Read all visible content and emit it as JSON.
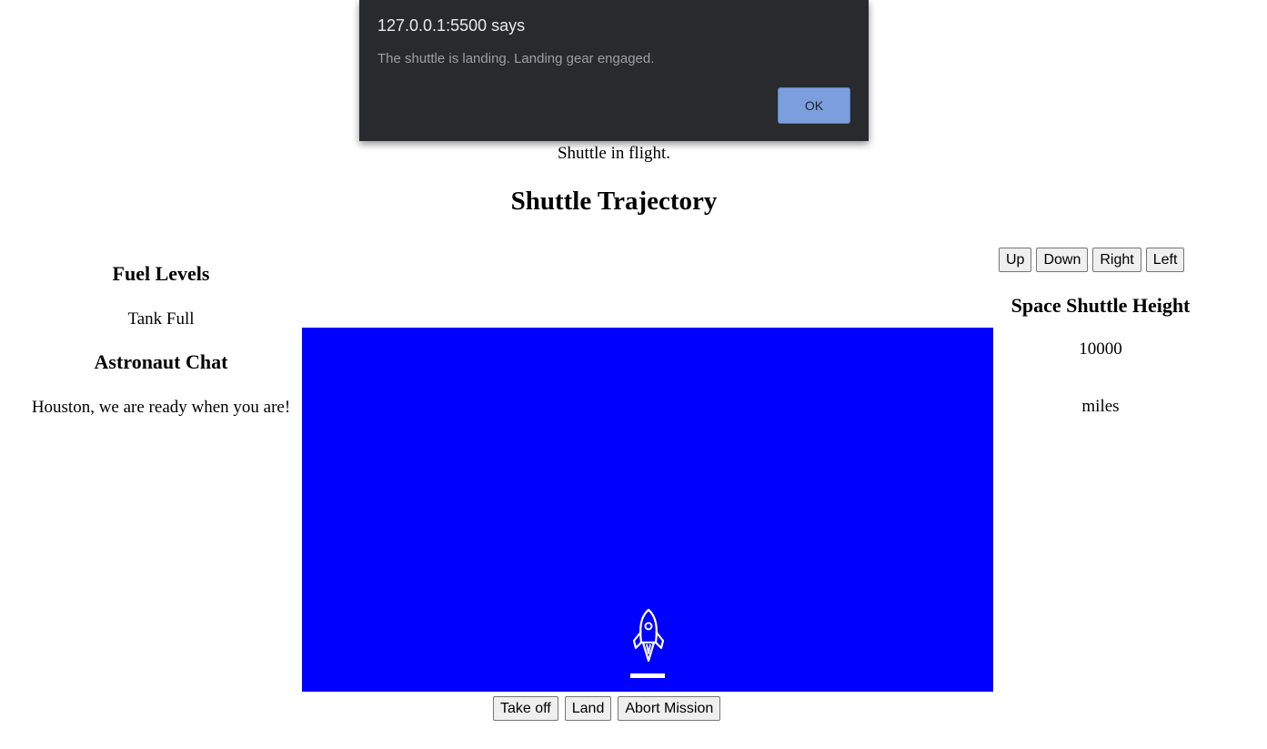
{
  "dialog": {
    "title": "127.0.0.1:5500 says",
    "message": "The shuttle is landing. Landing gear engaged.",
    "ok_label": "OK"
  },
  "flight_status": "Shuttle in flight.",
  "trajectory_title": "Shuttle Trajectory",
  "fuel": {
    "title": "Fuel Levels",
    "status": "Tank Full"
  },
  "chat": {
    "title": "Astronaut Chat",
    "message": "Houston, we are ready when you are!"
  },
  "direction_buttons": {
    "up": "Up",
    "down": "Down",
    "right": "Right",
    "left": "Left"
  },
  "height": {
    "title": "Space Shuttle Height",
    "value": "10000",
    "unit": "miles"
  },
  "mission_buttons": {
    "take_off": "Take off",
    "land": "Land",
    "abort": "Abort Mission"
  },
  "colors": {
    "shuttle_background": "#0000ff",
    "dialog_background": "#292a2d",
    "ok_button": "#7b9fdc"
  },
  "icons": {
    "shuttle": "rocket-icon"
  }
}
